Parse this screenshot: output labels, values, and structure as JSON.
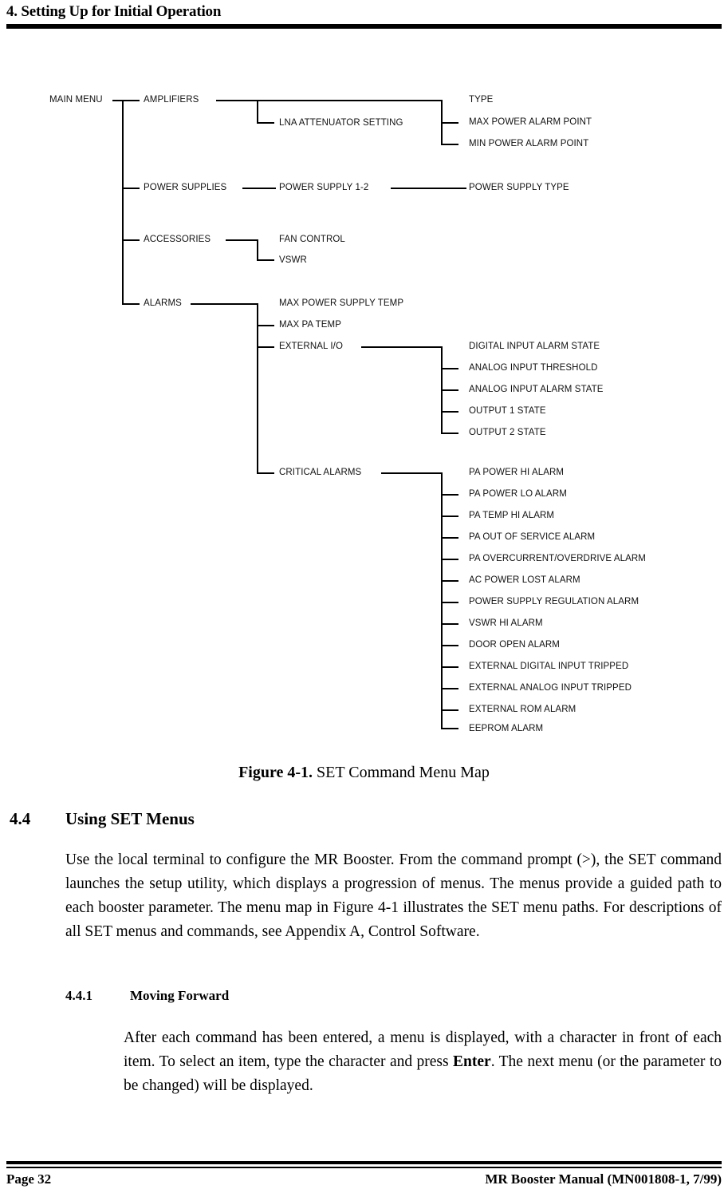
{
  "header": {
    "chapter_title": "4. Setting Up for Initial Operation"
  },
  "figure": {
    "caption_label": "Figure 4-1.",
    "caption_text": " SET Command Menu Map",
    "tree": {
      "root": "MAIN MENU",
      "level1": [
        {
          "label": "AMPLIFIERS"
        },
        {
          "label": "POWER SUPPLIES"
        },
        {
          "label": "ACCESSORIES"
        },
        {
          "label": "ALARMS"
        }
      ],
      "amplifiers_children": [
        "LNA ATTENUATOR SETTING"
      ],
      "amplifiers_grandchildren": [
        "TYPE",
        "MAX POWER ALARM POINT",
        "MIN POWER ALARM POINT"
      ],
      "power_supplies_children": [
        "POWER SUPPLY 1-2"
      ],
      "power_supplies_grandchildren": [
        "POWER SUPPLY TYPE"
      ],
      "accessories_children": [
        "FAN CONTROL",
        "VSWR"
      ],
      "alarms_children": [
        "MAX POWER SUPPLY TEMP",
        "MAX PA TEMP",
        "EXTERNAL I/O",
        "CRITICAL ALARMS"
      ],
      "external_io_children": [
        "DIGITAL INPUT ALARM STATE",
        "ANALOG INPUT THRESHOLD",
        "ANALOG INPUT ALARM STATE",
        "OUTPUT 1 STATE",
        "OUTPUT 2 STATE"
      ],
      "critical_alarms_children": [
        "PA POWER HI ALARM",
        "PA POWER LO ALARM",
        "PA TEMP HI ALARM",
        "PA OUT OF SERVICE ALARM",
        "PA OVERCURRENT/OVERDRIVE ALARM",
        "AC POWER LOST ALARM",
        "POWER SUPPLY REGULATION ALARM",
        "VSWR HI ALARM",
        "DOOR OPEN ALARM",
        "EXTERNAL DIGITAL INPUT TRIPPED",
        "EXTERNAL ANALOG INPUT TRIPPED",
        "EXTERNAL ROM ALARM",
        "EEPROM ALARM"
      ]
    }
  },
  "sections": {
    "s44_number": "4.4",
    "s44_title": "Using SET Menus",
    "s44_paragraph_a": "Use the local terminal to configure the MR Booster. From the command prompt (",
    "s44_paragraph_prompt": ">",
    "s44_paragraph_b": "), the SET command launches the setup utility, which displays a progression of menus. The menus provide a guided path to each booster parameter.  The menu map in Figure 4-1 illustrates the SET menu paths.  For descriptions of all SET menus and commands, see Appendix A, Control Software.",
    "s441_number": "4.4.1",
    "s441_title": "Moving Forward",
    "s441_paragraph_a": "After each command has been entered, a menu is displayed, with a character in front of each item.  To select an item, type the character and  press ",
    "s441_paragraph_bold": "Enter",
    "s441_paragraph_b": ". The next menu (or the parameter to be changed) will be displayed."
  },
  "footer": {
    "page_label": "Page 32",
    "manual_label": "MR Booster Manual (MN001808-1, 7/99)"
  },
  "colors": {
    "ink": "#000000",
    "paper": "#ffffff"
  }
}
